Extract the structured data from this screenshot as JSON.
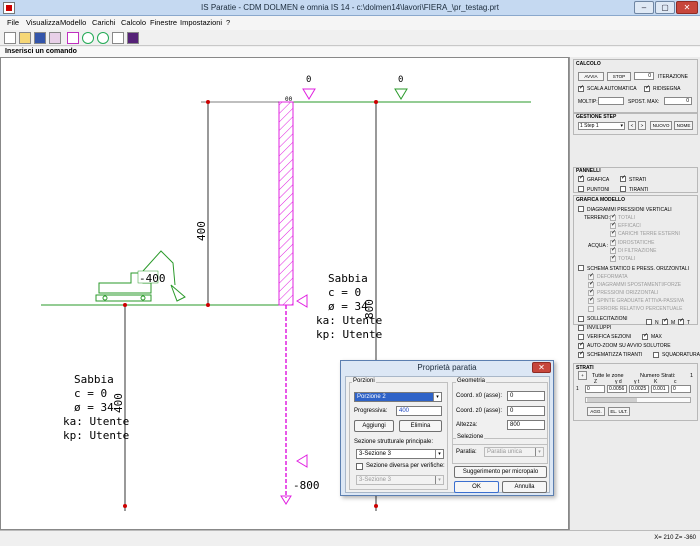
{
  "window": {
    "title": "IS Paratie - CDM DOLMEN e omnia IS 14 - c:\\dolmen14\\lavori\\FIERA_\\pr_testag.prt",
    "minimize": "–",
    "maximize": "▢",
    "close": "✕"
  },
  "menu": [
    "File",
    "Visualizza",
    "Modello",
    "Carichi",
    "Calcolo",
    "Finestre",
    "Impostazioni",
    "?"
  ],
  "command": {
    "label": "Inserisci un comando"
  },
  "drawing": {
    "top_load_left": "0",
    "top_load_right": "0",
    "wall_head_label": "00",
    "dim_height": "400",
    "left_level": "-400",
    "soil_right": [
      "Sabbia",
      "c = 0",
      "ø = 34",
      "ka: Utente",
      "kp: Utente"
    ],
    "dim_right": "800",
    "soil_left": [
      "Sabbia",
      "c = 0",
      "ø = 34",
      "ka: Utente",
      "kp: Utente"
    ],
    "dim_left": "400",
    "bottom_level": "-800"
  },
  "panel": {
    "calcolo": {
      "header": "CALCOLO",
      "avvia": "AVVIA",
      "stop": "STOP",
      "iterations_value": "0",
      "iterazione": "ITERAZIONE",
      "scala_automatica": "SCALA AUTOMATICA",
      "ridisegna": "RIDISEGNA",
      "moltip": "MOLTIP:",
      "spost_max": "SPOST. MAX:",
      "spost_value": "0"
    },
    "gestione_step": {
      "header": "GESTIONE STEP",
      "step_value": "1 Step 1",
      "prev": "<",
      "next": ">",
      "nuovo": "NUOVO",
      "nome": "NOME"
    },
    "pannelli": {
      "header": "PANNELLI",
      "grafica": "GRAFICA",
      "strati": "STRATI",
      "puntoni": "PUNTONI",
      "tiranti": "TIRANTI"
    },
    "grafica_modello": {
      "header": "GRAFICA MODELLO",
      "diagrammi": "DIAGRAMMI PRESSIONI VERTICALI",
      "terreno": "TERRENO:",
      "totali": "TOTALI",
      "efficaci": "EFFICACI",
      "carichi_terre": "CARICHI TERRE ESTERNI",
      "acqua": "ACQUA :",
      "idrostatiche": "IDROSTATICHE",
      "filtrazione": "DI FILTRAZIONE",
      "totali_acqua": "TOTALI",
      "schema": "SCHEMA STATICO E PRESS. ORIZZONTALI",
      "deformata": "DEFORMATA",
      "diagrammi_spost": "DIAGRAMMI SPOSTAMENTI/FORZE",
      "pressioni": "PRESSIONI ORIZZONTALI",
      "spinte": "SPINTE GRADUATE ATTIVA-PASSIVA",
      "errore": "ERRORE RELATIVO PERCENTUALE",
      "sollecitazioni": "SOLLECITAZIONI",
      "n": "N",
      "m": "M",
      "t": "T",
      "inviluppi": "INVILUPPI",
      "verifica": "VERIFICA SEZIONI",
      "max": "MAX",
      "auto_zoom": "AUTO-ZOOM SU AVVIO SOLUTORE",
      "schematizza": "SCHEMATIZZA TIRANTI",
      "squadratura": "SQUADRATURA"
    },
    "strati": {
      "header": "STRATI",
      "tutte_zone": "Tutte le zone",
      "numero_strati": "Numero Strati:",
      "numero_value": "1",
      "columns": [
        "Z",
        "γ d",
        "γ t",
        "K",
        "c"
      ],
      "row": [
        "1",
        "0",
        "0.0056",
        "0.0025",
        "0.001",
        "0"
      ],
      "agg": "AGG.",
      "el_ult": "EL. ULT."
    }
  },
  "status": {
    "coords": "X= 210 Z= -360"
  },
  "dialog": {
    "title": "Proprietà paratia",
    "close": "✕",
    "porzioni_label": "Porzioni",
    "porzione_value": "Porzione 2",
    "progressiva_label": "Progressiva:",
    "progressiva_value": "400",
    "aggiungi": "Aggiungi",
    "elimina": "Elimina",
    "sezione_label": "Sezione strutturale principale:",
    "sezione_value": "3-Sezione 3",
    "diversa_label": "Sezione diversa per verifiche:",
    "diversa_value": "3-Sezione 3",
    "geometria_label": "Geometria",
    "x0_label": "Coord. x0 (asse):",
    "x0_value": "0",
    "z0_label": "Coord. z0 (asse):",
    "z0_value": "0",
    "altezza_label": "Altezza:",
    "altezza_value": "800",
    "selezione_label": "Selezione",
    "paratia_label": "Paratia:",
    "paratia_value": "Paratia unica",
    "suggerimento": "Suggerimento per micropalo",
    "ok": "OK",
    "annulla": "Annulla"
  }
}
